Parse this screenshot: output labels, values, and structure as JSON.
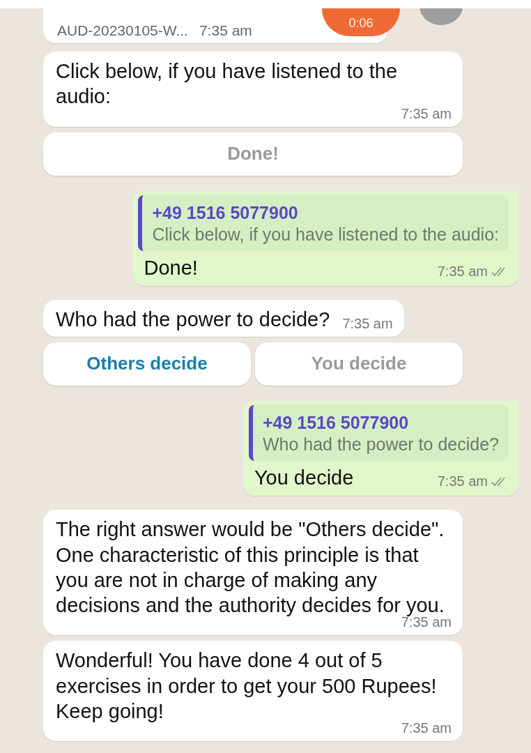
{
  "messages": [
    {
      "kind": "audio",
      "file_name": "AUD-20230105-W...",
      "time": "7:35 am",
      "duration": "0:06"
    },
    {
      "kind": "incoming",
      "text": "Click below, if you have listened to the audio:",
      "time": "7:35 am"
    },
    {
      "kind": "buttons",
      "buttons": [
        {
          "label": "Done!",
          "disabled": true
        }
      ]
    },
    {
      "kind": "outgoing",
      "quote_author": "+49 1516 5077900",
      "quote_text": "Click below, if you have listened to the audio:",
      "text": "Done!",
      "time": "7:35 am"
    },
    {
      "kind": "incoming",
      "text": "Who had the power to decide?",
      "time": "7:35 am"
    },
    {
      "kind": "buttons",
      "buttons": [
        {
          "label": "Others decide",
          "disabled": false
        },
        {
          "label": "You decide",
          "disabled": true
        }
      ]
    },
    {
      "kind": "outgoing",
      "quote_author": "+49 1516 5077900",
      "quote_text": "Who had the power to decide?",
      "text": "You decide",
      "time": "7:35 am"
    },
    {
      "kind": "incoming",
      "text": "The right answer would be \"Others decide\". One characteristic of this principle is that you are not in charge of making any decisions and the authority decides for you.",
      "time": "7:35 am"
    },
    {
      "kind": "incoming",
      "text": "Wonderful! You have done 4 out of 5 exercises in order to get your 500 Rupees! Keep going!",
      "time": "7:35 am"
    }
  ]
}
